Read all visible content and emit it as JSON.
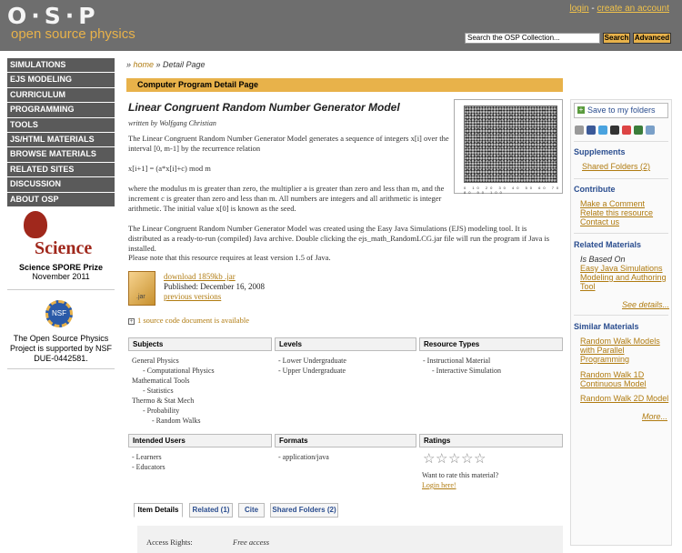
{
  "header": {
    "logo_text": "O·S·P",
    "logo_sub": "open source physics",
    "login": "login",
    "sep": " - ",
    "create_account": "create an account",
    "search_value": "Search the OSP Collection...",
    "search_btn": "Search",
    "advanced_btn": "Advanced"
  },
  "nav": [
    "SIMULATIONS",
    "EJS MODELING",
    "CURRICULUM",
    "PROGRAMMING",
    "TOOLS",
    "JS/HTML MATERIALS",
    "BROWSE MATERIALS",
    "RELATED SITES",
    "DISCUSSION",
    "ABOUT OSP"
  ],
  "prize": {
    "logo": "Science",
    "line1": "Science SPORE Prize",
    "line2": "November 2011"
  },
  "nsf": {
    "logo": "NSF",
    "text1": "The Open Source Physics",
    "text2": "Project is supported by NSF",
    "text3": "DUE-0442581."
  },
  "crumb": {
    "prefix": "» ",
    "home": "home",
    "rest": " » Detail Page"
  },
  "bar": "Computer Program Detail Page",
  "resource": {
    "title": "Linear Congruent Random Number Generator Model",
    "author": "written by Wolfgang Christian",
    "p1": "The Linear Congruent Random Number Generator Model generates a sequence of integers x[i] over the interval [0, m-1] by the recurrence relation",
    "formula": "x[i+1] = (a*x[i]+c) mod m",
    "p2": "where the modulus m is greater than zero, the multiplier a is greater than zero and less than m, and the increment c is greater than zero and less than m. All numbers are integers and all arithmetic is integer arithmetic. The initial value x[0] is known as the seed.",
    "p3": "The Linear Congruent Random Number Generator Model was created using the Easy Java Simulations (EJS) modeling tool.  It is distributed as a ready-to-run (compiled) Java archive.  Double clicking the ejs_math_RandomLCG.jar file will run the program if Java is installed.",
    "p4": "Please note that this resource requires at least version 1.5 of Java.",
    "thumb_axis": "0 10 20 30 40 50 60 70 80 90 100",
    "jar_label": ".jar",
    "download": "download 1859kb .jar",
    "published": "Published: December 16, 2008",
    "previous": "previous versions",
    "source_doc": "1 source code document is available"
  },
  "table": {
    "subjects_h": "Subjects",
    "levels_h": "Levels",
    "types_h": "Resource Types",
    "subjects": [
      "General Physics",
      "- Computational Physics",
      "Mathematical Tools",
      "- Statistics",
      "Thermo & Stat Mech",
      "- Probability",
      "- Random Walks"
    ],
    "levels": [
      "- Lower Undergraduate",
      "- Upper Undergraduate"
    ],
    "types": [
      "- Instructional Material",
      "- Interactive Simulation"
    ],
    "users_h": "Intended Users",
    "formats_h": "Formats",
    "ratings_h": "Ratings",
    "users": [
      "- Learners",
      "- Educators"
    ],
    "formats": [
      "- application/java"
    ],
    "rate_q": "Want to rate this material?",
    "rate_login": "Login here!",
    "star": "☆"
  },
  "tabs": [
    "Item Details",
    "Related (1)",
    "Cite",
    "Shared Folders (2)"
  ],
  "details": {
    "label": "Access Rights:",
    "value": "Free access"
  },
  "sidebar": {
    "save": "Save to my folders",
    "supplements": "Supplements",
    "shared": "Shared Folders (2)",
    "contribute": "Contribute",
    "comment": "Make a Comment",
    "relate": "Relate this resource",
    "contact": "Contact us",
    "related": "Related Materials",
    "based": "Is Based On",
    "ejs1": "Easy Java Simulations",
    "ejs2": "Modeling and Authoring",
    "ejs3": "Tool",
    "see": "See details...",
    "similar": "Similar Materials",
    "s1a": "Random Walk Models",
    "s1b": "with Parallel",
    "s1c": "Programming",
    "s2a": "Random Walk 1D",
    "s2b": "Continuous Model",
    "s3": "Random Walk 2D Model",
    "more": "More..."
  }
}
